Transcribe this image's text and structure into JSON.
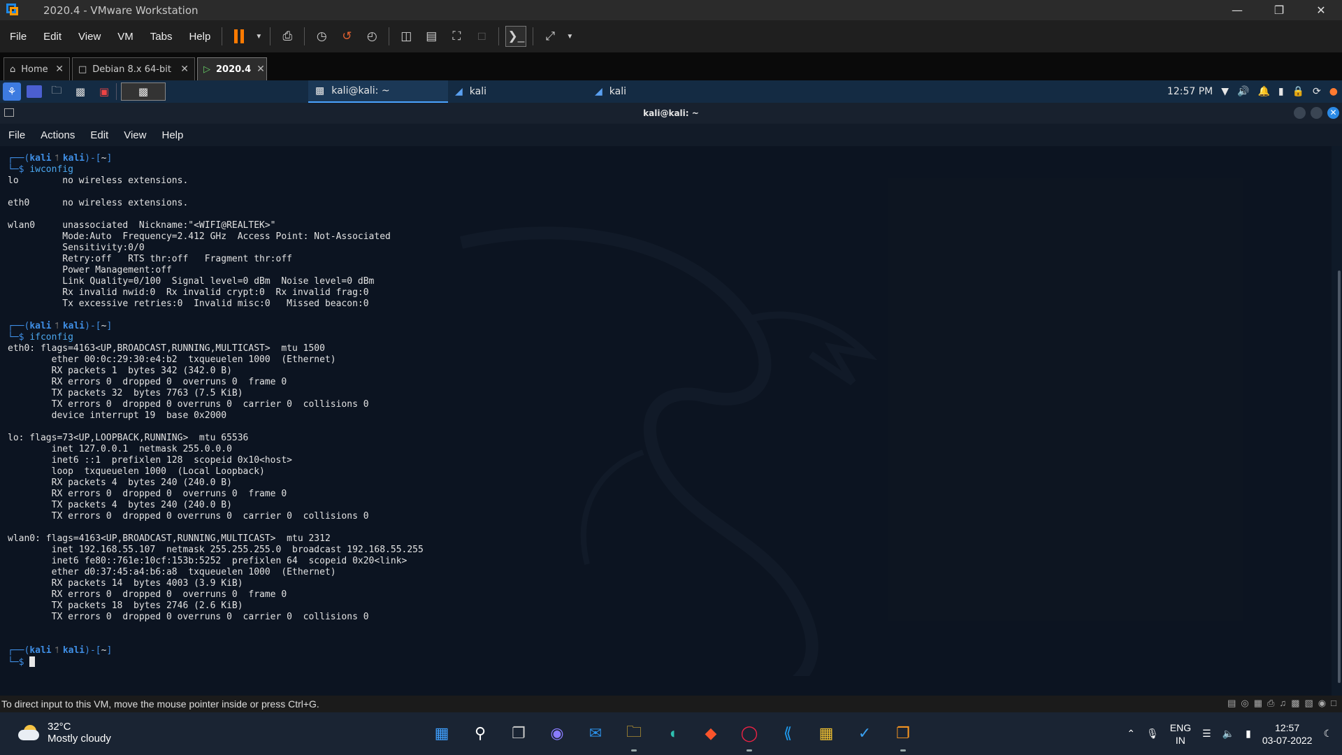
{
  "vmware": {
    "title": "2020.4 - VMware Workstation",
    "menu": [
      "File",
      "Edit",
      "View",
      "VM",
      "Tabs",
      "Help"
    ],
    "tabs": [
      {
        "label": "Home",
        "icon": "home-icon"
      },
      {
        "label": "Debian 8.x 64-bit",
        "icon": "vm-icon"
      },
      {
        "label": "2020.4",
        "icon": "vm-running-icon",
        "active": true
      }
    ],
    "status_message": "To direct input to this VM, move the mouse pointer inside or press Ctrl+G."
  },
  "kali_panel": {
    "tasks": [
      {
        "label": "kali@kali: ~",
        "active": true
      },
      {
        "label": "kali"
      },
      {
        "label": "kali"
      }
    ],
    "time": "12:57 PM"
  },
  "terminal": {
    "title": "kali@kali: ~",
    "menu": [
      "File",
      "Actions",
      "Edit",
      "View",
      "Help"
    ],
    "user": "kali",
    "host": "kali",
    "dir": "~",
    "commands": [
      "iwconfig",
      "ifconfig"
    ],
    "iwconfig_output": "lo        no wireless extensions.\n\neth0      no wireless extensions.\n\nwlan0     unassociated  Nickname:\"<WIFI@REALTEK>\"\n          Mode:Auto  Frequency=2.412 GHz  Access Point: Not-Associated\n          Sensitivity:0/0\n          Retry:off   RTS thr:off   Fragment thr:off\n          Power Management:off\n          Link Quality=0/100  Signal level=0 dBm  Noise level=0 dBm\n          Rx invalid nwid:0  Rx invalid crypt:0  Rx invalid frag:0\n          Tx excessive retries:0  Invalid misc:0   Missed beacon:0\n",
    "ifconfig_output": "eth0: flags=4163<UP,BROADCAST,RUNNING,MULTICAST>  mtu 1500\n        ether 00:0c:29:30:e4:b2  txqueuelen 1000  (Ethernet)\n        RX packets 1  bytes 342 (342.0 B)\n        RX errors 0  dropped 0  overruns 0  frame 0\n        TX packets 32  bytes 7763 (7.5 KiB)\n        TX errors 0  dropped 0 overruns 0  carrier 0  collisions 0\n        device interrupt 19  base 0x2000\n\nlo: flags=73<UP,LOOPBACK,RUNNING>  mtu 65536\n        inet 127.0.0.1  netmask 255.0.0.0\n        inet6 ::1  prefixlen 128  scopeid 0x10<host>\n        loop  txqueuelen 1000  (Local Loopback)\n        RX packets 4  bytes 240 (240.0 B)\n        RX errors 0  dropped 0  overruns 0  frame 0\n        TX packets 4  bytes 240 (240.0 B)\n        TX errors 0  dropped 0 overruns 0  carrier 0  collisions 0\n\nwlan0: flags=4163<UP,BROADCAST,RUNNING,MULTICAST>  mtu 2312\n        inet 192.168.55.107  netmask 255.255.255.0  broadcast 192.168.55.255\n        inet6 fe80::761e:10cf:153b:5252  prefixlen 64  scopeid 0x20<link>\n        ether d0:37:45:a4:b6:a8  txqueuelen 1000  (Ethernet)\n        RX packets 14  bytes 4003 (3.9 KiB)\n        RX errors 0  dropped 0  overruns 0  frame 0\n        TX packets 18  bytes 2746 (2.6 KiB)\n        TX errors 0  dropped 0 overruns 0  carrier 0  collisions 0\n\n"
  },
  "taskbar": {
    "temperature": "32°C",
    "weather": "Mostly cloudy",
    "lang1": "ENG",
    "lang2": "IN",
    "time": "12:57",
    "date": "03-07-2022",
    "apps": [
      "windows-start-icon",
      "search-icon",
      "task-view-icon",
      "teams-chat-icon",
      "mail-icon",
      "file-explorer-icon",
      "edge-icon",
      "brave-icon",
      "chrome-icon",
      "vscode-icon",
      "store-icon",
      "browser-icon",
      "vmware-icon"
    ]
  },
  "colors": {
    "accent": "#3f8fe6",
    "vm_pause": "#ff7a00",
    "kali_panel": "#142b43"
  }
}
